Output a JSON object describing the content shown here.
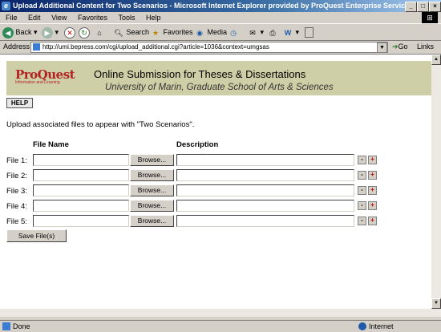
{
  "window": {
    "title": "Upload Additional Content for Two Scenarios - Microsoft Internet Explorer provided by ProQuest Enterprise Services"
  },
  "menubar": {
    "items": [
      "File",
      "Edit",
      "View",
      "Favorites",
      "Tools",
      "Help"
    ]
  },
  "toolbar": {
    "back_label": "Back",
    "search_label": "Search",
    "favorites_label": "Favorites",
    "media_label": "Media"
  },
  "addressbar": {
    "label": "Address",
    "url": "http://umi.bepress.com/cgi/upload_additional.cgi?article=1036&context=umgsas",
    "go_label": "Go",
    "links_label": "Links"
  },
  "page": {
    "logo_text": "ProQuest",
    "logo_subtext": "Information and Learning",
    "header_title": "Online Submission for Theses & Dissertations",
    "header_subtitle": "University of Marin, Graduate School of Arts & Sciences",
    "help_label": "HELP",
    "intro_text": "Upload associated files to appear with \"Two Scenarios\".",
    "col_file_name": "File Name",
    "col_description": "Description",
    "rows": [
      {
        "label": "File 1:",
        "browse": "Browse..."
      },
      {
        "label": "File 2:",
        "browse": "Browse..."
      },
      {
        "label": "File 3:",
        "browse": "Browse..."
      },
      {
        "label": "File 4:",
        "browse": "Browse..."
      },
      {
        "label": "File 5:",
        "browse": "Browse..."
      }
    ],
    "minus_symbol": "-",
    "plus_symbol": "+",
    "save_label": "Save File(s)"
  },
  "status": {
    "text": "Done",
    "zone": "Internet"
  },
  "colors": {
    "header_band": "#cfcfa7",
    "logo_red": "#b22222",
    "titlebar": "#0a246a"
  }
}
